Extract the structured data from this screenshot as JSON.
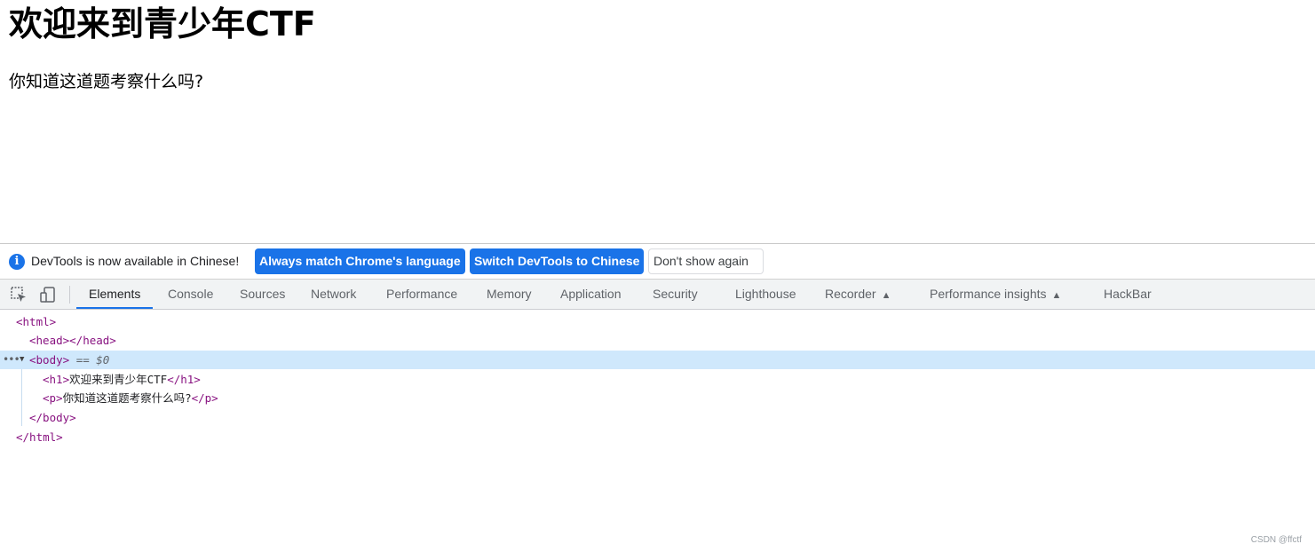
{
  "page": {
    "heading": "欢迎来到青少年CTF",
    "paragraph": "你知道这道题考察什么吗?"
  },
  "infobar": {
    "icon": "info-icon",
    "message": "DevTools is now available in Chinese!",
    "btn_match_language": "Always match Chrome's language",
    "btn_switch_chinese": "Switch DevTools to Chinese",
    "btn_dont_show": "Don't show again"
  },
  "toolbar": {
    "icons": [
      "inspect-element-icon",
      "device-toolbar-icon"
    ],
    "tabs": {
      "elements": "Elements",
      "console": "Console",
      "sources": "Sources",
      "network": "Network",
      "performance": "Performance",
      "memory": "Memory",
      "application": "Application",
      "security": "Security",
      "lighthouse": "Lighthouse",
      "recorder": "Recorder",
      "performance_insights": "Performance insights",
      "hackbar": "HackBar"
    },
    "active_tab": "Elements"
  },
  "dom_tree": {
    "html_open": "<html>",
    "head": "<head></head>",
    "body_open": "<body>",
    "selected_marker": "== $0",
    "h1_open": "<h1>",
    "h1_text": "欢迎来到青少年CTF",
    "h1_close": "</h1>",
    "p_open": "<p>",
    "p_text": "你知道这道题考察什么吗?",
    "p_close": "</p>",
    "body_close": "</body>",
    "html_close": "</html>"
  },
  "watermark": "CSDN @ffctf",
  "colors": {
    "accent": "#1a73e8",
    "tag": "#881280",
    "selection": "#cfe8fc"
  }
}
